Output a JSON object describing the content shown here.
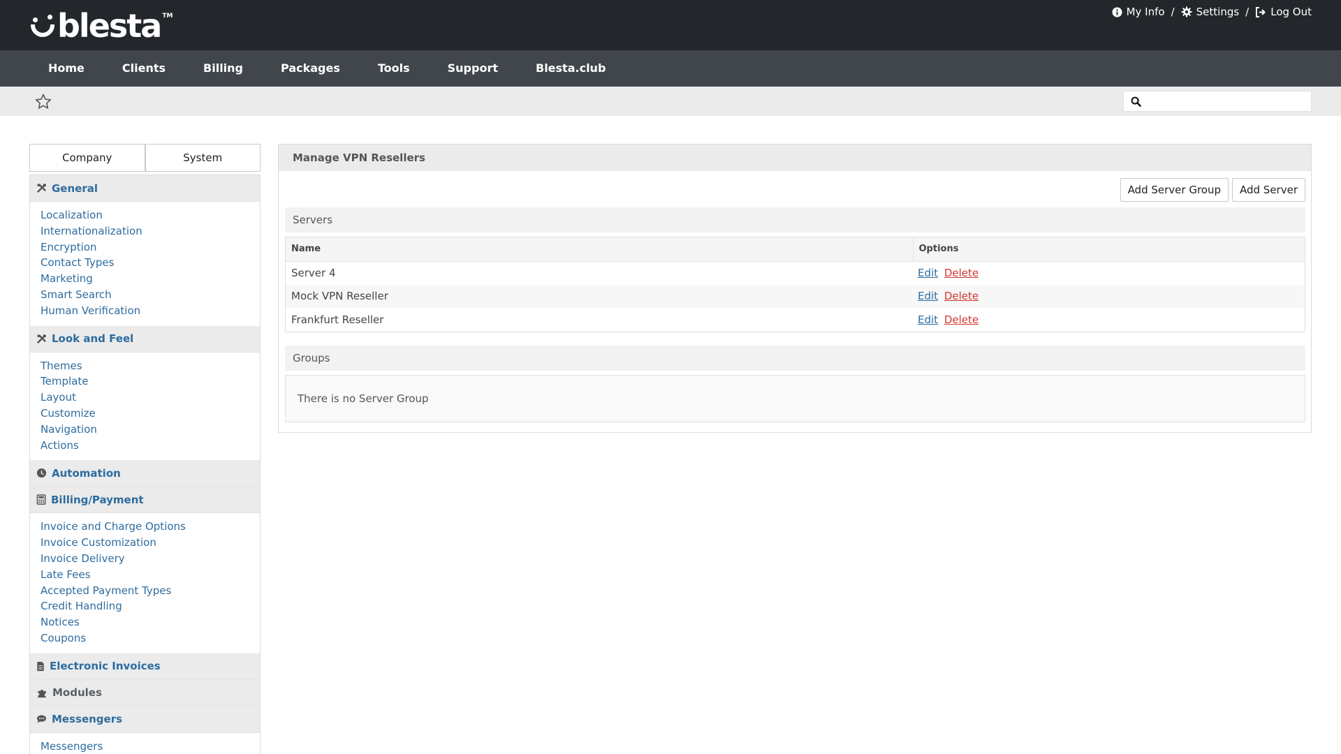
{
  "brand": {
    "name": "blesta",
    "tm": "TM"
  },
  "toplinks": [
    {
      "label": "My Info",
      "icon": "info-icon"
    },
    {
      "label": "Settings",
      "icon": "gear-icon"
    },
    {
      "label": "Log Out",
      "icon": "logout-icon"
    }
  ],
  "toplinks_sep": "/",
  "nav": [
    "Home",
    "Clients",
    "Billing",
    "Packages",
    "Tools",
    "Support",
    "Blesta.club"
  ],
  "search": {
    "placeholder": "",
    "value": ""
  },
  "sidebar": {
    "tabs": [
      "Company",
      "System"
    ],
    "sections": [
      {
        "label": "General",
        "icon": "tools-icon",
        "links": [
          "Localization",
          "Internationalization",
          "Encryption",
          "Contact Types",
          "Marketing",
          "Smart Search",
          "Human Verification"
        ]
      },
      {
        "label": "Look and Feel",
        "icon": "tools-icon",
        "links": [
          "Themes",
          "Template",
          "Layout",
          "Customize",
          "Navigation",
          "Actions"
        ]
      },
      {
        "label": "Automation",
        "icon": "clock-icon",
        "links": []
      },
      {
        "label": "Billing/Payment",
        "icon": "calculator-icon",
        "links": [
          "Invoice and Charge Options",
          "Invoice Customization",
          "Invoice Delivery",
          "Late Fees",
          "Accepted Payment Types",
          "Credit Handling",
          "Notices",
          "Coupons"
        ]
      },
      {
        "label": "Electronic Invoices",
        "icon": "document-icon",
        "links": []
      },
      {
        "label": "Modules",
        "icon": "puzzle-icon",
        "links": []
      },
      {
        "label": "Messengers",
        "icon": "chat-icon",
        "links": [
          "Messengers"
        ]
      }
    ]
  },
  "main": {
    "title": "Manage VPN Resellers",
    "buttons": {
      "add_group": "Add Server Group",
      "add_server": "Add Server"
    },
    "servers_heading": "Servers",
    "columns": {
      "name": "Name",
      "options": "Options"
    },
    "rows": [
      {
        "name": "Server 4",
        "edit": "Edit",
        "delete": "Delete"
      },
      {
        "name": "Mock VPN Reseller",
        "edit": "Edit",
        "delete": "Delete"
      },
      {
        "name": "Frankfurt Reseller",
        "edit": "Edit",
        "delete": "Delete"
      }
    ],
    "groups_heading": "Groups",
    "groups_empty": "There is no Server Group"
  },
  "colors": {
    "header": "#23272b",
    "nav": "#40464c",
    "link": "#2d6c9e",
    "delete": "#d1362f"
  }
}
